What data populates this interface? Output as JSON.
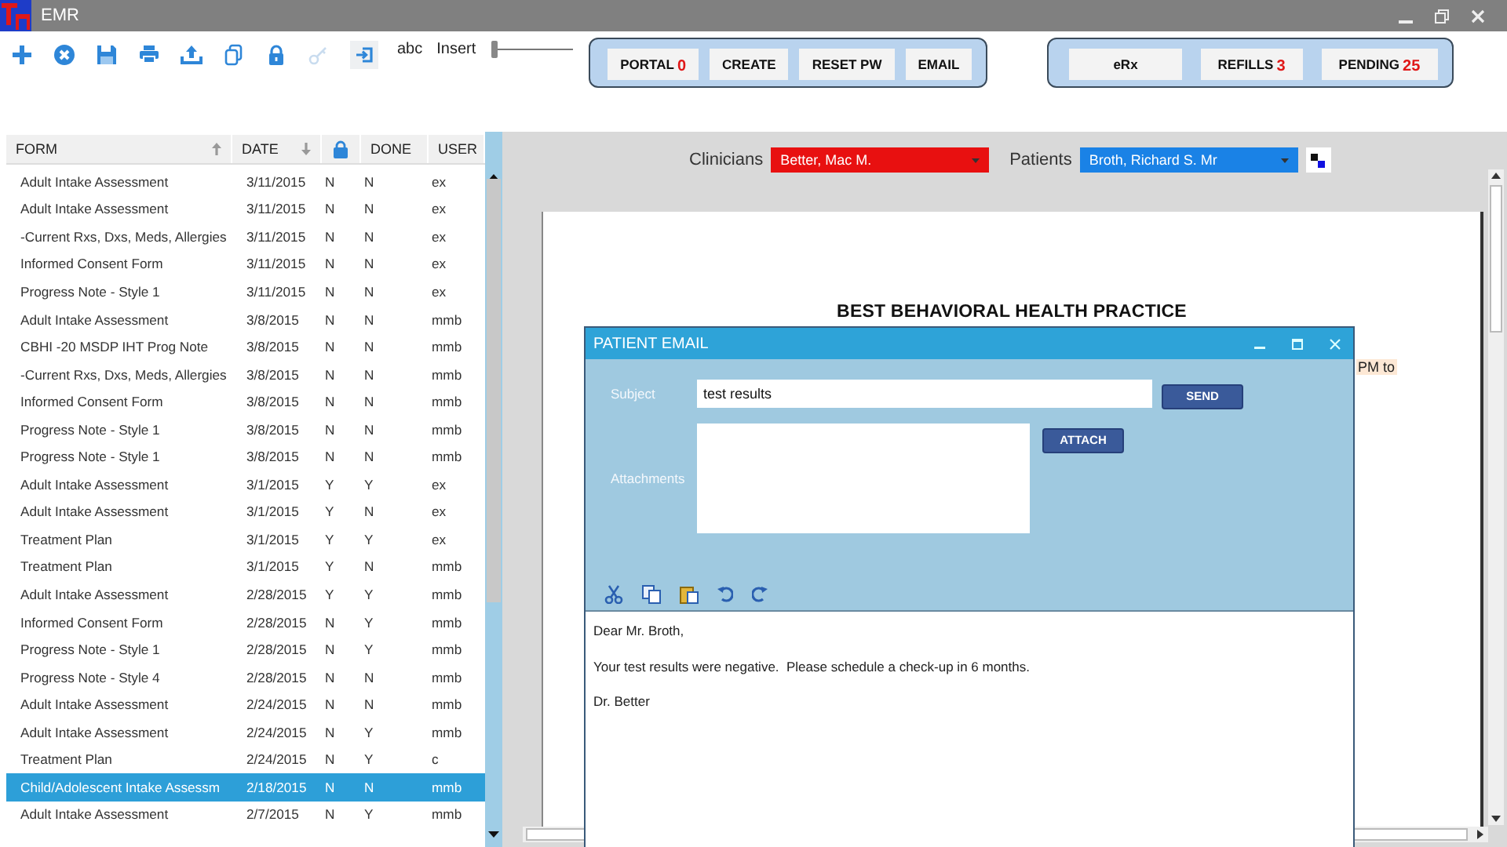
{
  "window": {
    "title": "EMR"
  },
  "toolbar": {
    "labels": [
      "abc",
      "Insert"
    ],
    "slider": {
      "level": 0
    }
  },
  "button_groups": [
    [
      {
        "label": "PORTAL",
        "count": "0"
      },
      {
        "label": "CREATE"
      },
      {
        "label": "RESET PW"
      },
      {
        "label": "EMAIL"
      }
    ],
    [
      {
        "label": "eRx"
      },
      {
        "label": "REFILLS",
        "count": "3"
      },
      {
        "label": "PENDING",
        "count": "25"
      }
    ]
  ],
  "forms": {
    "columns": [
      {
        "label": "FORM",
        "kind": "ascending"
      },
      {
        "label": "DATE",
        "kind": "descending"
      },
      {
        "kind": "lock"
      },
      {
        "label": "DONE",
        "kind": "plain"
      },
      {
        "label": "USER",
        "kind": "plain"
      }
    ],
    "rows": [
      {
        "form": "Adult Intake Assessment",
        "date": "3/11/2015",
        "lock": "N",
        "done": "N",
        "user": "ex",
        "selected": false
      },
      {
        "form": "Adult Intake Assessment",
        "date": "3/11/2015",
        "lock": "N",
        "done": "N",
        "user": "ex",
        "selected": false
      },
      {
        "form": "-Current Rxs, Dxs, Meds, Allergies",
        "date": "3/11/2015",
        "lock": "N",
        "done": "N",
        "user": "ex",
        "selected": false
      },
      {
        "form": "Informed Consent Form",
        "date": "3/11/2015",
        "lock": "N",
        "done": "N",
        "user": "ex",
        "selected": false
      },
      {
        "form": "Progress Note - Style 1",
        "date": "3/11/2015",
        "lock": "N",
        "done": "N",
        "user": "ex",
        "selected": false
      },
      {
        "form": "Adult Intake Assessment",
        "date": "3/8/2015",
        "lock": "N",
        "done": "N",
        "user": "mmb",
        "selected": false
      },
      {
        "form": "CBHI -20 MSDP IHT Prog Note",
        "date": "3/8/2015",
        "lock": "N",
        "done": "N",
        "user": "mmb",
        "selected": false
      },
      {
        "form": "-Current Rxs, Dxs, Meds, Allergies",
        "date": "3/8/2015",
        "lock": "N",
        "done": "N",
        "user": "mmb",
        "selected": false
      },
      {
        "form": "Informed Consent Form",
        "date": "3/8/2015",
        "lock": "N",
        "done": "N",
        "user": "mmb",
        "selected": false
      },
      {
        "form": "Progress Note - Style 1",
        "date": "3/8/2015",
        "lock": "N",
        "done": "N",
        "user": "mmb",
        "selected": false
      },
      {
        "form": "Progress Note - Style 1",
        "date": "3/8/2015",
        "lock": "N",
        "done": "N",
        "user": "mmb",
        "selected": false
      },
      {
        "form": "Adult Intake Assessment",
        "date": "3/1/2015",
        "lock": "Y",
        "done": "Y",
        "user": "ex",
        "selected": false
      },
      {
        "form": "Adult Intake Assessment",
        "date": "3/1/2015",
        "lock": "Y",
        "done": "N",
        "user": "ex",
        "selected": false
      },
      {
        "form": "Treatment Plan",
        "date": "3/1/2015",
        "lock": "Y",
        "done": "Y",
        "user": "ex",
        "selected": false
      },
      {
        "form": "Treatment Plan",
        "date": "3/1/2015",
        "lock": "Y",
        "done": "N",
        "user": "mmb",
        "selected": false
      },
      {
        "form": "Adult Intake Assessment",
        "date": "2/28/2015",
        "lock": "Y",
        "done": "Y",
        "user": "mmb",
        "selected": false
      },
      {
        "form": "Informed Consent Form",
        "date": "2/28/2015",
        "lock": "N",
        "done": "Y",
        "user": "mmb",
        "selected": false
      },
      {
        "form": "Progress Note - Style 1",
        "date": "2/28/2015",
        "lock": "N",
        "done": "Y",
        "user": "mmb",
        "selected": false
      },
      {
        "form": "Progress Note - Style 4",
        "date": "2/28/2015",
        "lock": "N",
        "done": "N",
        "user": "mmb",
        "selected": false
      },
      {
        "form": "Adult Intake Assessment",
        "date": "2/24/2015",
        "lock": "N",
        "done": "N",
        "user": "mmb",
        "selected": false
      },
      {
        "form": "Adult Intake Assessment",
        "date": "2/24/2015",
        "lock": "N",
        "done": "Y",
        "user": "mmb",
        "selected": false
      },
      {
        "form": "Treatment Plan",
        "date": "2/24/2015",
        "lock": "N",
        "done": "Y",
        "user": "c",
        "selected": false
      },
      {
        "form": "Child/Adolescent Intake Assessm",
        "date": "2/18/2015",
        "lock": "N",
        "done": "N",
        "user": "mmb",
        "selected": true
      },
      {
        "form": "Adult Intake Assessment",
        "date": "2/7/2015",
        "lock": "N",
        "done": "Y",
        "user": "mmb",
        "selected": false
      }
    ]
  },
  "selectors": [
    {
      "label": "Clinicians",
      "value": "Better, Mac M.",
      "color": "#e81010"
    },
    {
      "label": "Patients",
      "value": "Broth, Richard S. Mr",
      "color": "#1a82e6"
    }
  ],
  "document": {
    "heading": "BEST BEHAVIORAL HEALTH PRACTICE",
    "fragment": "PM to"
  },
  "email_dialog": {
    "title": "PATIENT EMAIL",
    "subject_label": "Subject",
    "subject": "test results",
    "attachments_label": "Attachments",
    "buttons": [
      "SEND",
      "ATTACH"
    ],
    "body": [
      "Dear Mr. Broth,",
      "Your test results were negative.  Please schedule a check-up in 6 months.",
      "Dr. Better"
    ]
  }
}
